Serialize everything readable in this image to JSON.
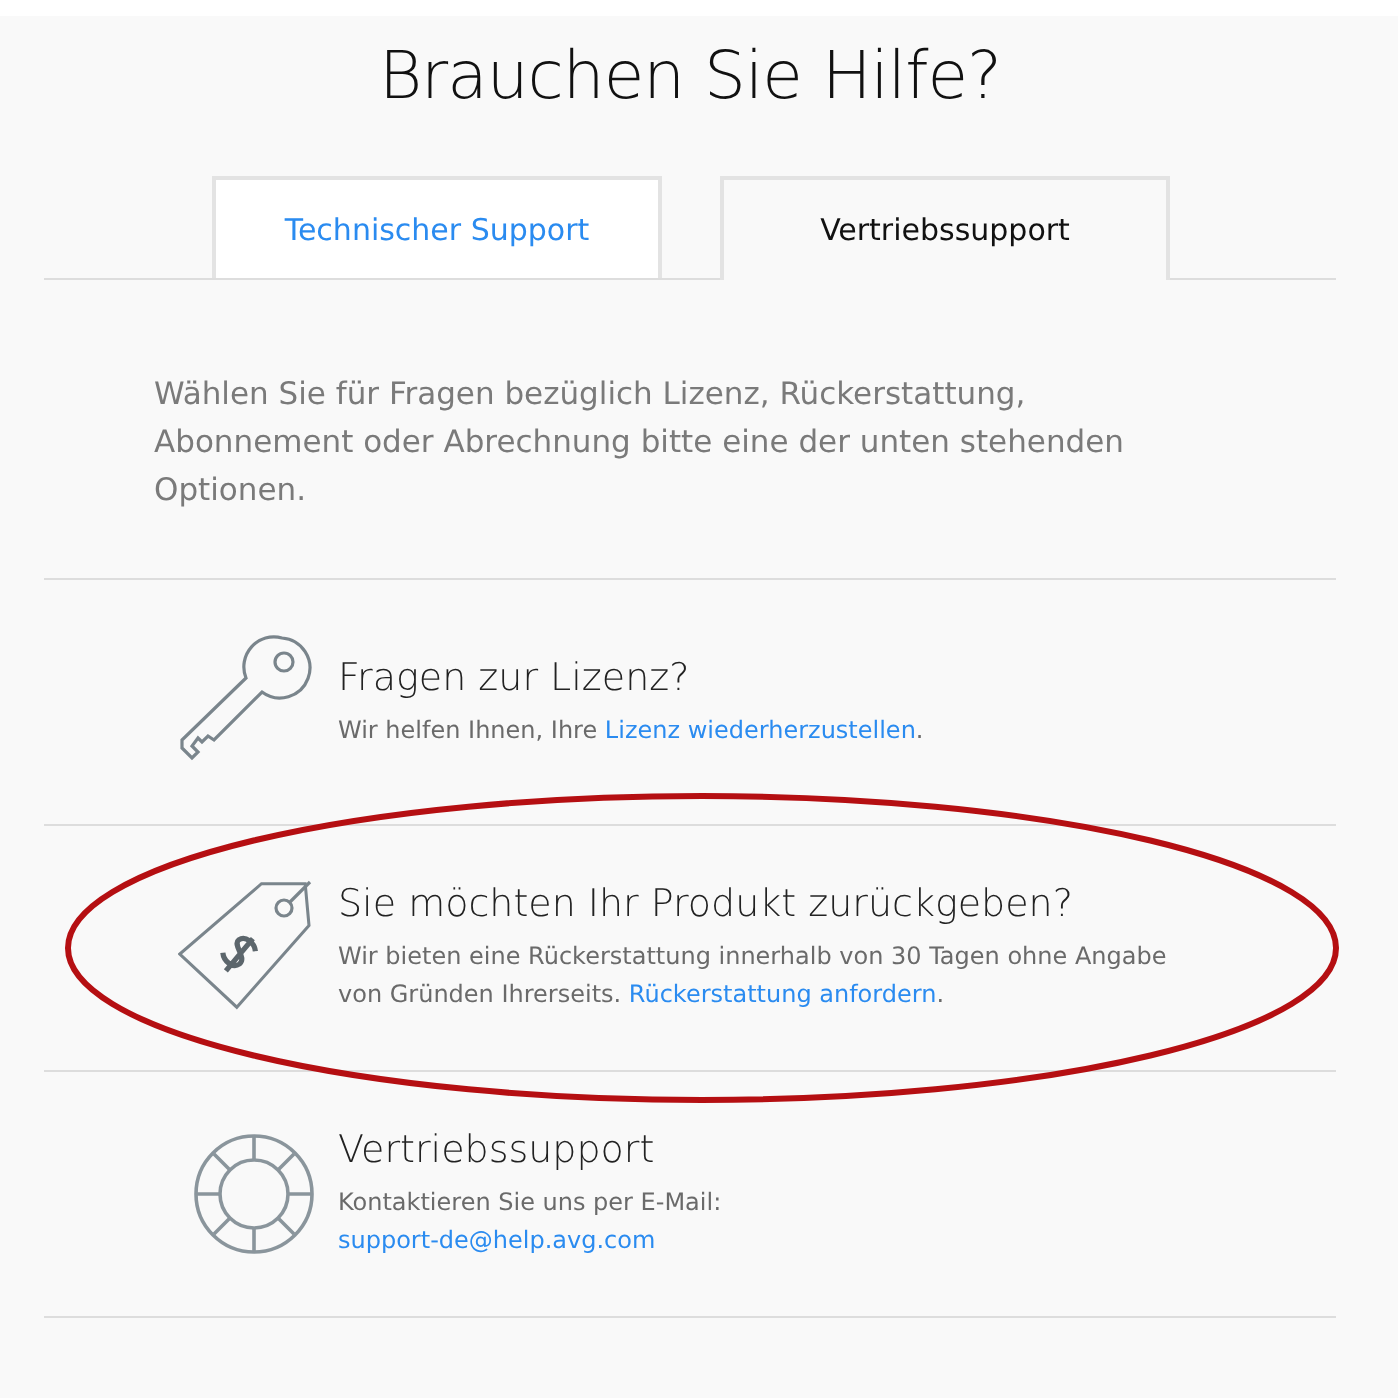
{
  "title": "Brauchen Sie Hilfe?",
  "tabs": [
    {
      "label": "Technischer Support",
      "selected": false
    },
    {
      "label": "Vertriebssupport",
      "selected": true
    }
  ],
  "intro": "Wählen Sie für Fragen bezüglich Lizenz, Rückerstattung, Abonnement oder Abrechnung bitte eine der unten stehenden Optionen.",
  "options": [
    {
      "kind": "key",
      "heading": "Fragen zur Lizenz?",
      "highlighted": false,
      "lines": [
        [
          {
            "text": "Wir helfen Ihnen, Ihre ",
            "link": false
          },
          {
            "text": "Lizenz wiederherzustellen",
            "link": true
          },
          {
            "text": ".",
            "link": false
          }
        ]
      ]
    },
    {
      "kind": "price-tag",
      "heading": "Sie möchten Ihr Produkt zurückgeben?",
      "highlighted": true,
      "lines": [
        [
          {
            "text": "Wir bieten eine Rückerstattung innerhalb von 30 Tagen ohne Angabe von Gründen Ihrerseits. ",
            "link": false
          },
          {
            "text": "Rückerstattung anfordern",
            "link": true
          },
          {
            "text": ".",
            "link": false
          }
        ]
      ]
    },
    {
      "kind": "lifebuoy",
      "heading": "Vertriebssupport",
      "highlighted": false,
      "lines": [
        [
          {
            "text": "Kontaktieren Sie uns per E-Mail:",
            "link": false
          }
        ],
        [
          {
            "text": "support-de@help.avg.com",
            "link": true
          }
        ]
      ]
    }
  ]
}
